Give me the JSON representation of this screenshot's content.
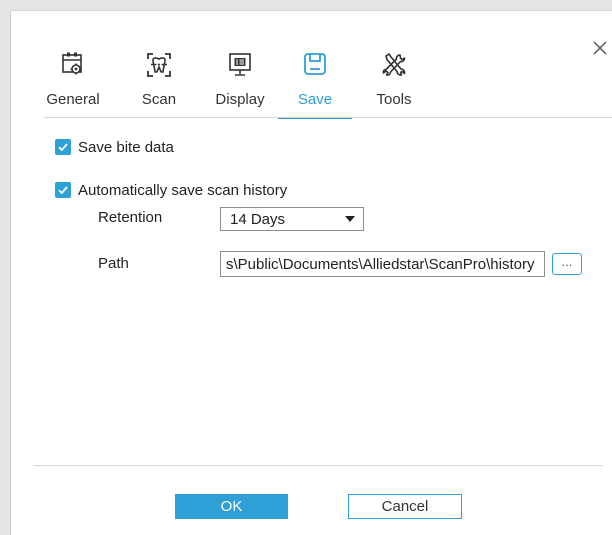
{
  "tabs": [
    {
      "label": "General",
      "icon": "general-settings-icon",
      "active": false
    },
    {
      "label": "Scan",
      "icon": "scan-tooth-icon",
      "active": false
    },
    {
      "label": "Display",
      "icon": "display-monitor-icon",
      "active": false
    },
    {
      "label": "Save",
      "icon": "save-disk-icon",
      "active": true
    },
    {
      "label": "Tools",
      "icon": "tools-wrench-icon",
      "active": false
    }
  ],
  "options": {
    "save_bite_data": {
      "label": "Save bite data",
      "checked": true
    },
    "auto_save_history": {
      "label": "Automatically save scan history",
      "checked": true
    }
  },
  "retention": {
    "label": "Retention",
    "value": "14 Days"
  },
  "path": {
    "label": "Path",
    "value": "s\\Public\\Documents\\Alliedstar\\ScanPro\\history",
    "browse_label": "..."
  },
  "buttons": {
    "ok": "OK",
    "cancel": "Cancel"
  },
  "colors": {
    "accent": "#2f9fd8",
    "background": "#ffffff",
    "window_backdrop": "#e4e5e7"
  }
}
